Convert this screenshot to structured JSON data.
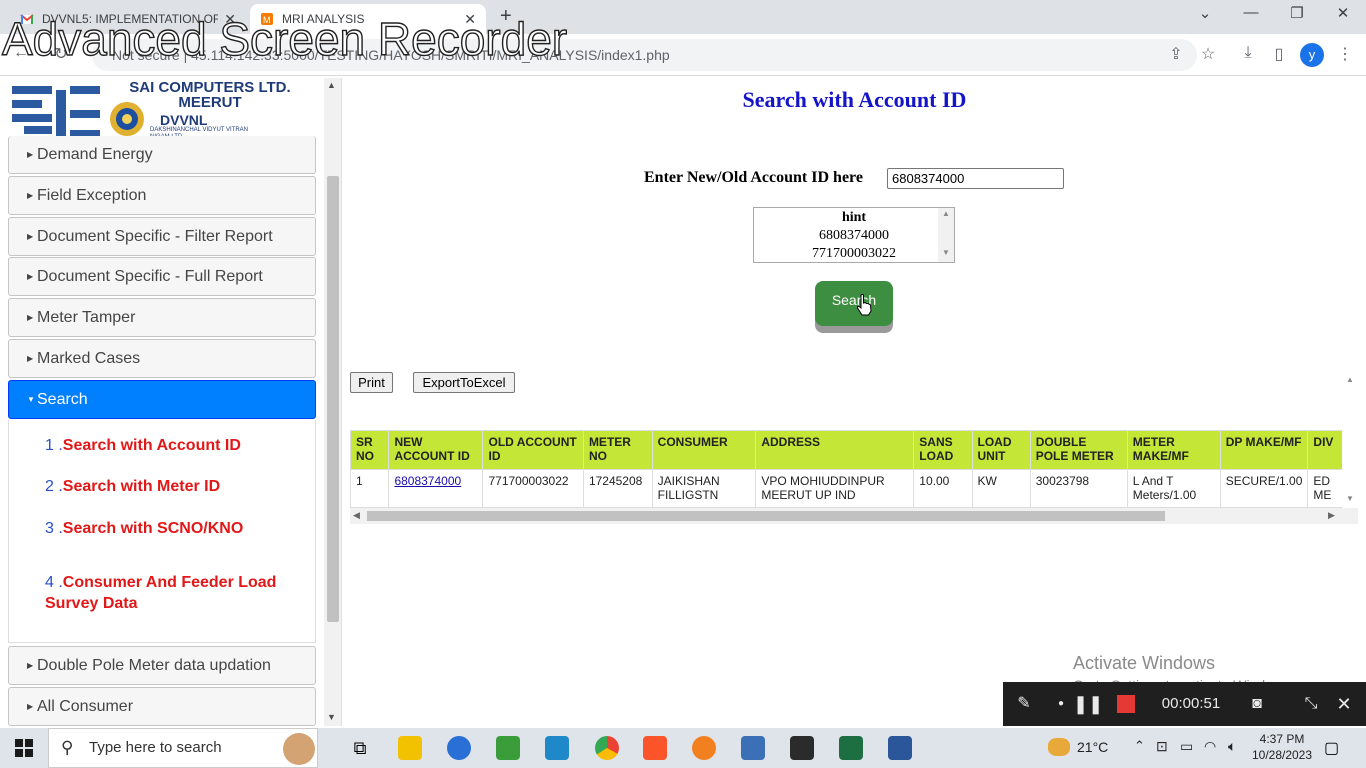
{
  "browser": {
    "tabs": [
      {
        "title": "DVVNL5: IMPLEMENTATION OF",
        "close": "✕"
      },
      {
        "title": "MRI ANALYSIS",
        "close": "✕"
      }
    ],
    "new_tab": "+",
    "url": "Not secure | 45.114.142.33:5000/TESTING/HAYOSH/SMRITI/MRI_ANALYSIS/index1.php",
    "profile_initial": "y",
    "window_controls": [
      "⌄",
      "—",
      "❐",
      "✕"
    ]
  },
  "watermark": "Advanced Screen Recorder",
  "logo": {
    "title_line1": "SAI COMPUTERS LTD.",
    "title_line2": "MEERUT",
    "org": "DVVNL",
    "org_sub": "DAKSHINANCHAL VIDYUT VITRAN NIGAM LTD"
  },
  "sidebar": {
    "sections": [
      {
        "label": "Demand Energy"
      },
      {
        "label": "Field Exception"
      },
      {
        "label": "Document Specific - Filter Report"
      },
      {
        "label": "Document Specific - Full Report"
      },
      {
        "label": "Meter Tamper"
      },
      {
        "label": "Marked Cases"
      },
      {
        "label": "Search",
        "active": true
      },
      {
        "label": "Double Pole Meter data updation"
      },
      {
        "label": "All Consumer"
      }
    ],
    "search_items": [
      {
        "num": "1 .",
        "label": "Search with Account ID"
      },
      {
        "num": "2 .",
        "label": "Search with Meter ID"
      },
      {
        "num": "3 .",
        "label": "Search with SCNO/KNO"
      },
      {
        "num": "4 .",
        "label": "Consumer And Feeder Load Survey Data"
      }
    ]
  },
  "main": {
    "title": "Search with Account ID",
    "account_label": "Enter New/Old Account ID here",
    "account_value": "6808374000",
    "hint": {
      "header": "hint",
      "values": [
        "6808374000",
        "771700003022"
      ]
    },
    "search_button": "Search",
    "print_button": "Print",
    "export_button": "ExportToExcel",
    "table": {
      "headers": [
        "SR NO",
        "NEW ACCOUNT ID",
        "OLD ACCOUNT ID",
        "METER NO",
        "CONSUMER",
        "ADDRESS",
        "SANS LOAD",
        "LOAD UNIT",
        "DOUBLE POLE METER",
        "METER MAKE/MF",
        "DP MAKE/MF",
        "DIV"
      ],
      "rows": [
        [
          "1",
          "6808374000",
          "771700003022",
          "17245208",
          "JAIKISHAN FILLIGSTN",
          "VPO MOHIUDDINPUR MEERUT UP IND",
          "10.00",
          "KW",
          "30023798",
          "L And T Meters/1.00",
          "SECURE/1.00",
          "ED ME"
        ]
      ]
    }
  },
  "os_notice": {
    "line1": "Activate Windows",
    "line2": "Go to Settings to activate Windows."
  },
  "recorder": {
    "timer": "00:00:51"
  },
  "taskbar": {
    "search_placeholder": "Type here to search",
    "weather": "21°C",
    "time": "4:37 PM",
    "date": "10/28/2023"
  },
  "colors": {
    "accent_active": "#007fff",
    "title_blue": "#1414c8",
    "link_red": "#e21818",
    "table_header": "#c4e637",
    "search_green": "#3e8e41"
  }
}
